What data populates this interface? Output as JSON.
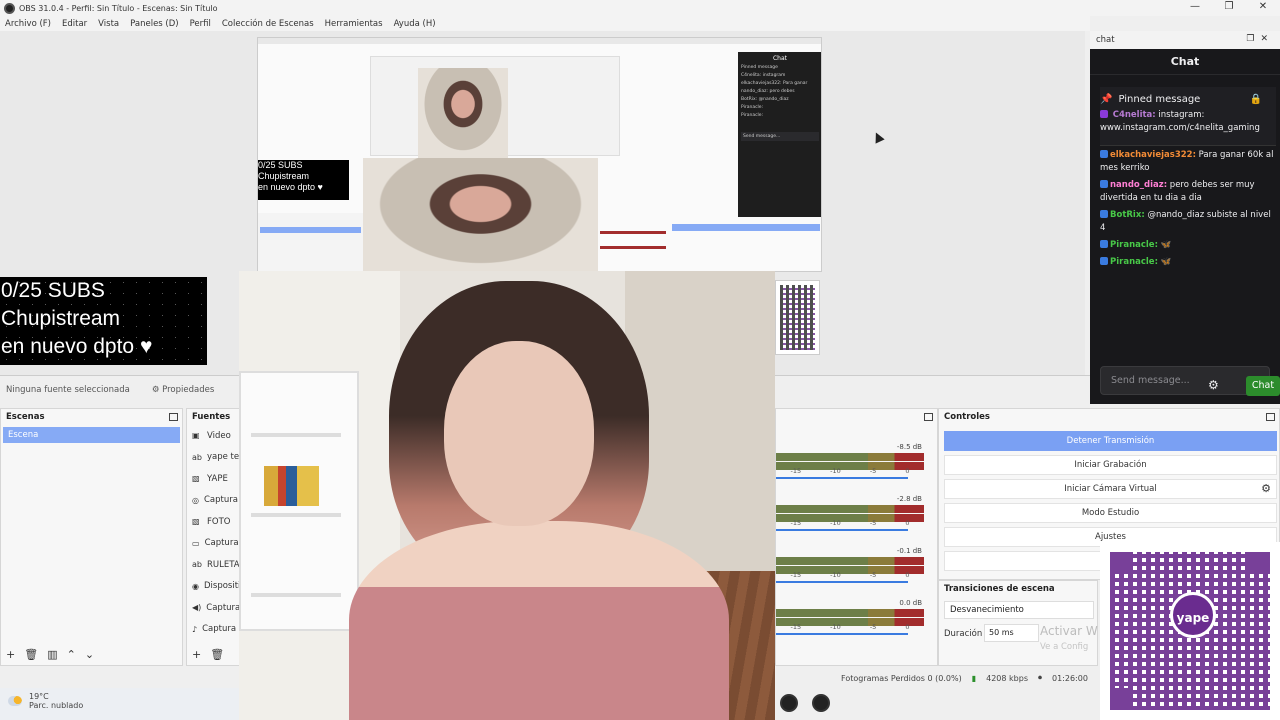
{
  "window": {
    "title": "OBS 31.0.4 - Perfil: Sin Título - Escenas: Sin Título",
    "controls": [
      "—",
      "❐",
      "✕"
    ]
  },
  "menu": [
    "Archivo (F)",
    "Editar",
    "Vista",
    "Paneles (D)",
    "Perfil",
    "Colección de Escenas",
    "Herramientas",
    "Ayuda (H)"
  ],
  "preview": {
    "overlay_lines": [
      "0/25 SUBS",
      "Chupistream",
      "en nuevo dpto ♥"
    ],
    "mini_overlay_lines": [
      "0/25 SUBS",
      "Chupistream",
      "en nuevo dpto ♥"
    ],
    "mini_chat_title": "Chat",
    "mini_chat_lines": [
      "Pinned message",
      "C4nelita: instagram",
      "elkachaviejas322: Para ganar",
      "nando_diaz: pero debes",
      "BotRix: @nando_diaz",
      "Piranacle:",
      "Piranacle:"
    ],
    "mini_chat_send": "Send message..."
  },
  "source_bar": {
    "no_source": "Ninguna fuente seleccionada",
    "properties": "Propiedades"
  },
  "scenes": {
    "title": "Escenas",
    "items": [
      "Escena"
    ]
  },
  "sources": {
    "title": "Fuentes",
    "items": [
      {
        "icon": "▣",
        "icon_name": "video-icon",
        "label": "Video"
      },
      {
        "icon": "ab",
        "icon_name": "text-icon",
        "label": "yape text"
      },
      {
        "icon": "▧",
        "icon_name": "image-icon",
        "label": "YAPE"
      },
      {
        "icon": "◎",
        "icon_name": "capture-icon",
        "label": "Captura de"
      },
      {
        "icon": "▧",
        "icon_name": "image-icon",
        "label": "FOTO"
      },
      {
        "icon": "▭",
        "icon_name": "window-icon",
        "label": "Captura de"
      },
      {
        "icon": "ab",
        "icon_name": "text-icon",
        "label": "RULETA"
      },
      {
        "icon": "◉",
        "icon_name": "device-icon",
        "label": "Dispositivo"
      },
      {
        "icon": "◀)",
        "icon_name": "audio-icon",
        "label": "Captura de"
      },
      {
        "icon": "♪",
        "icon_name": "mic-icon",
        "label": "Captura de"
      }
    ]
  },
  "mixer": {
    "tracks": [
      {
        "db": "-8.5 dB",
        "ticks": [
          "-15",
          "-10",
          "-5",
          "0"
        ]
      },
      {
        "db": "-2.8 dB",
        "ticks": [
          "-15",
          "-10",
          "-5",
          "0"
        ]
      },
      {
        "db": "-0.1 dB",
        "ticks": [
          "-15",
          "-10",
          "-5",
          "0"
        ]
      },
      {
        "db": "0.0 dB",
        "ticks": [
          "-15",
          "-10",
          "-5",
          "0"
        ]
      }
    ]
  },
  "controls": {
    "title": "Controles",
    "buttons": [
      "Detener Transmisión",
      "Iniciar Grabación",
      "Iniciar Cámara Virtual",
      "Modo Estudio",
      "Ajustes"
    ]
  },
  "transitions": {
    "title": "Transiciones de escena",
    "selected": "Desvanecimiento",
    "duration_label": "Duración",
    "duration_value": "50 ms"
  },
  "watermark": {
    "line1": "Activar W",
    "line2": "Ve a Config"
  },
  "status": {
    "dropped": "Fotogramas Perdidos 0 (0.0%)",
    "bitrate": "4208 kbps",
    "time": "01:26:00"
  },
  "weather": {
    "temp": "19°C",
    "desc": "Parc. nublado"
  },
  "chat": {
    "dock_title": "chat",
    "title": "Chat",
    "pinned_title": "Pinned message",
    "pinned_user": "C4nelita:",
    "pinned_text": "instagram: www.instagram.com/c4nelita_gaming",
    "messages": [
      {
        "user": "elkachaviejas322:",
        "color": "u-orange",
        "text": "Para ganar 60k al mes kerriko"
      },
      {
        "user": "nando_diaz:",
        "color": "u-pink",
        "text": "pero debes ser muy divertida en tu dia a dia"
      },
      {
        "user": "BotRix:",
        "color": "u-green",
        "text": "@nando_diaz subiste al nivel 4"
      },
      {
        "user": "Piranacle:",
        "color": "u-green",
        "text": "🦋"
      },
      {
        "user": "Piranacle:",
        "color": "u-green",
        "text": "🦋"
      }
    ],
    "input_placeholder": "Send message...",
    "send_label": "Chat"
  },
  "yape_logo": "yape",
  "colors": {
    "accent": "#7aa0f3",
    "chat_bg": "#18181b",
    "send_green": "#2c8c2c",
    "yape_purple": "#6a2c8f"
  }
}
